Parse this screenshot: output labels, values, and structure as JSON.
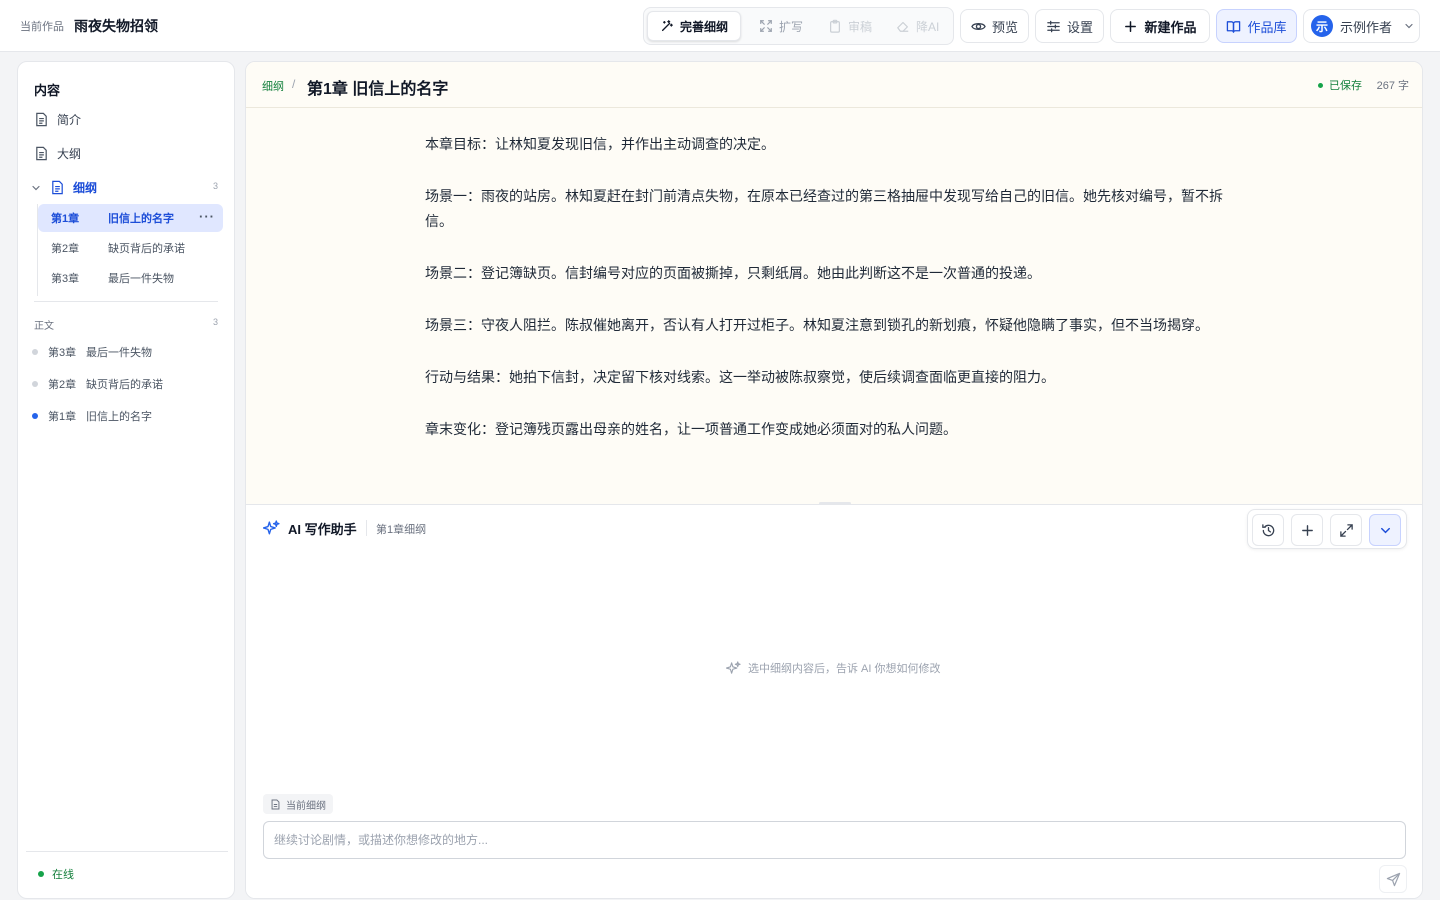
{
  "header": {
    "current_label": "当前作品",
    "work_title": "雨夜失物招领",
    "tools": [
      {
        "label": "完善细纲",
        "icon": "magic-wand-icon"
      },
      {
        "label": "扩写",
        "icon": "expand-icon"
      },
      {
        "label": "审稿",
        "icon": "clipboard-icon"
      },
      {
        "label": "降AI",
        "icon": "eraser-icon"
      }
    ],
    "preview_label": "预览",
    "settings_label": "设置",
    "new_work_label": "新建作品",
    "library_label": "作品库",
    "user": {
      "avatar_char": "示",
      "name": "示例作者"
    }
  },
  "sidebar": {
    "heading": "内容",
    "intro_label": "简介",
    "outline_label": "大纲",
    "detail_outline": {
      "label": "细纲",
      "count": "3"
    },
    "chapters": [
      {
        "num": "第1章",
        "name": "旧信上的名字",
        "active": true
      },
      {
        "num": "第2章",
        "name": "缺页背后的承诺",
        "active": false
      },
      {
        "num": "第3章",
        "name": "最后一件失物",
        "active": false
      }
    ],
    "text_section": {
      "label": "正文",
      "count": "3"
    },
    "text_items": [
      {
        "num": "第3章",
        "name": "最后一件失物"
      },
      {
        "num": "第2章",
        "name": "缺页背后的承诺"
      },
      {
        "num": "第1章",
        "name": "旧信上的名字"
      }
    ],
    "status": "在线"
  },
  "editor": {
    "breadcrumb_parent": "细纲",
    "breadcrumb_sep": "/",
    "title": "第1章 旧信上的名字",
    "saved_label": "已保存",
    "word_count": "267 字",
    "paragraphs": [
      "本章目标：让林知夏发现旧信，并作出主动调查的决定。",
      "场景一：雨夜的站房。林知夏赶在封门前清点失物，在原本已经查过的第三格抽屉中发现写给自己的旧信。她先核对编号，暂不拆信。",
      "场景二：登记簿缺页。信封编号对应的页面被撕掉，只剩纸屑。她由此判断这不是一次普通的投递。",
      "场景三：守夜人阻拦。陈叔催她离开，否认有人打开过柜子。林知夏注意到锁孔的新划痕，怀疑他隐瞒了事实，但不当场揭穿。",
      "行动与结果：她拍下信封，决定留下核对线索。这一举动被陈叔察觉，使后续调查面临更直接的阻力。",
      "章末变化：登记簿残页露出母亲的姓名，让一项普通工作变成她必须面对的私人问题。"
    ]
  },
  "ai_panel": {
    "title": "AI 写作助手",
    "context": "第1章细纲",
    "hint": "选中细纲内容后，告诉 AI 你想如何修改",
    "chip_label": "当前细纲",
    "input_placeholder": "继续讨论剧情，或描述你想修改的地方..."
  },
  "colors": {
    "accent": "#2563eb",
    "success": "#16a34a",
    "editor_bg": "#fefcf6"
  }
}
